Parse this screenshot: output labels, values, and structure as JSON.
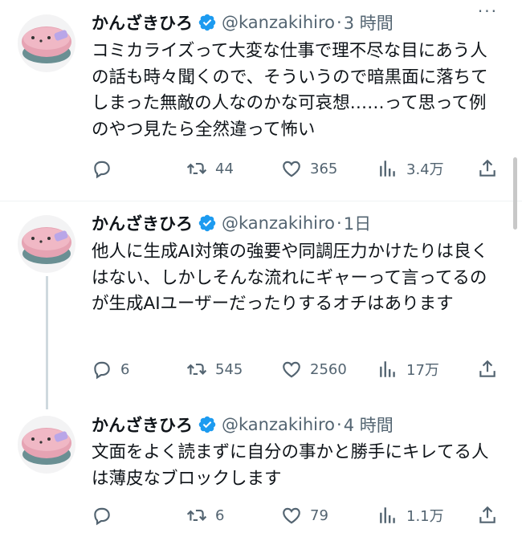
{
  "tweets": [
    {
      "name": "かんざきひろ",
      "handle": "@kanzakihiro",
      "dot": "·",
      "time": "3 時間",
      "more": "···",
      "text": "コミカライズって大変な仕事で理不尽な目にあう人の話も時々聞くので、そういうので暗黒面に落ちてしまった無敵の人なのかな可哀想……って思って例のやつ見たら全然違って怖い",
      "reply_count": "",
      "retweet_count": "44",
      "like_count": "365",
      "view_count": "3.4万"
    },
    {
      "name": "かんざきひろ",
      "handle": "@kanzakihiro",
      "dot": "·",
      "time": "1日",
      "more": "",
      "text": "他人に生成AI対策の強要や同調圧力かけたりは良くはない、しかしそんな流れにギャーって言ってるのが生成AIユーザーだったりするオチはあります",
      "reply_count": "6",
      "retweet_count": "545",
      "like_count": "2560",
      "view_count": "17万"
    },
    {
      "name": "かんざきひろ",
      "handle": "@kanzakihiro",
      "dot": "·",
      "time": "4 時間",
      "more": "",
      "text": "文面をよく読まずに自分の事かと勝手にキレてる人は薄皮なブロックします",
      "reply_count": "",
      "retweet_count": "6",
      "like_count": "79",
      "view_count": "1.1万"
    }
  ],
  "icons": {
    "verified": "verified-badge-icon",
    "reply": "reply-icon",
    "retweet": "retweet-icon",
    "like": "heart-icon",
    "views": "views-chart-icon",
    "share": "share-icon"
  },
  "colors": {
    "text": "#0f1419",
    "secondary": "#536471",
    "verified": "#1d9bf0",
    "avatar": "#e6a3b3",
    "divider": "#eff3f4"
  }
}
